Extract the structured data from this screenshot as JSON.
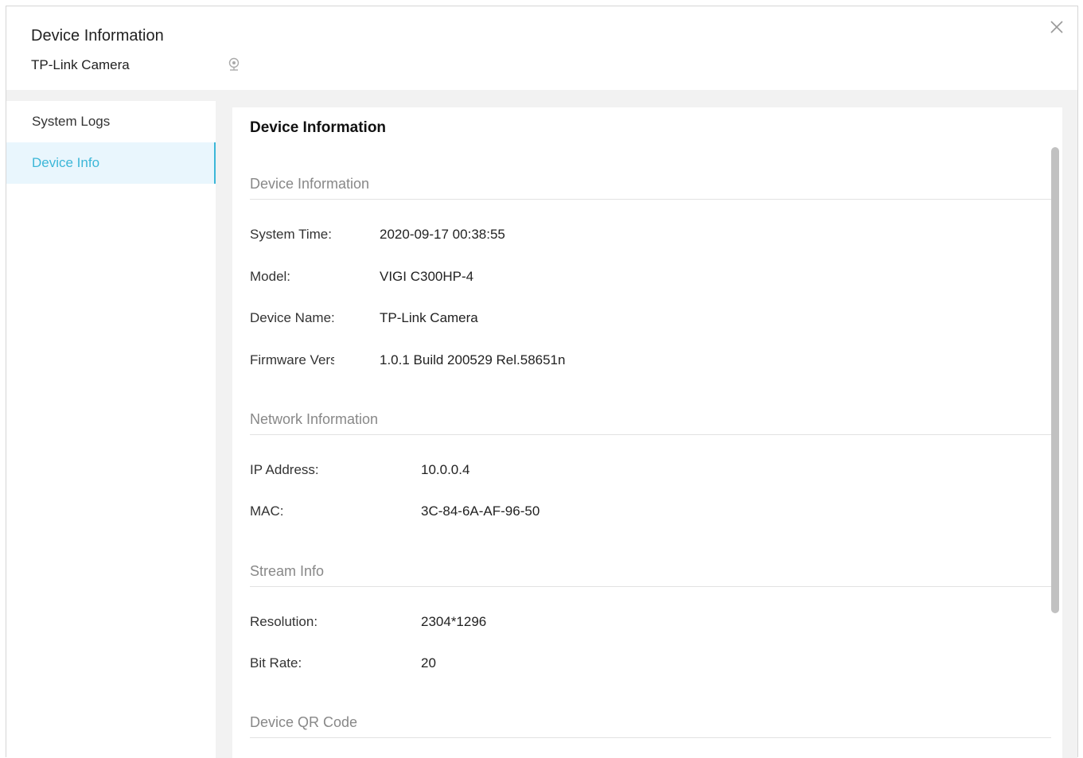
{
  "header": {
    "title": "Device Information",
    "device_name": "TP-Link Camera"
  },
  "sidebar": {
    "items": [
      {
        "label": "System Logs",
        "active": false
      },
      {
        "label": "Device Info",
        "active": true
      }
    ]
  },
  "panel": {
    "title": "Device Information",
    "sections": {
      "device": {
        "title": "Device Information",
        "rows": [
          {
            "label": "System Time:",
            "value": "2020-09-17 00:38:55"
          },
          {
            "label": "Model:",
            "value": "VIGI C300HP-4"
          },
          {
            "label": "Device Name:",
            "value": "TP-Link Camera"
          },
          {
            "label": "Firmware Version:",
            "value": "1.0.1 Build 200529 Rel.58651n"
          }
        ]
      },
      "network": {
        "title": "Network Information",
        "rows": [
          {
            "label": "IP Address:",
            "value": "10.0.0.4"
          },
          {
            "label": "MAC:",
            "value": "3C-84-6A-AF-96-50"
          }
        ]
      },
      "stream": {
        "title": "Stream Info",
        "rows": [
          {
            "label": "Resolution:",
            "value": "2304*1296"
          },
          {
            "label": "Bit Rate:",
            "value": "20"
          }
        ]
      },
      "qr": {
        "title": "Device QR Code"
      }
    }
  },
  "icons": {
    "close": "close-icon",
    "camera": "camera-icon"
  },
  "colors": {
    "accent": "#3cb7d8",
    "active_bg": "#e9f6fd",
    "content_bg": "#f2f2f2"
  }
}
